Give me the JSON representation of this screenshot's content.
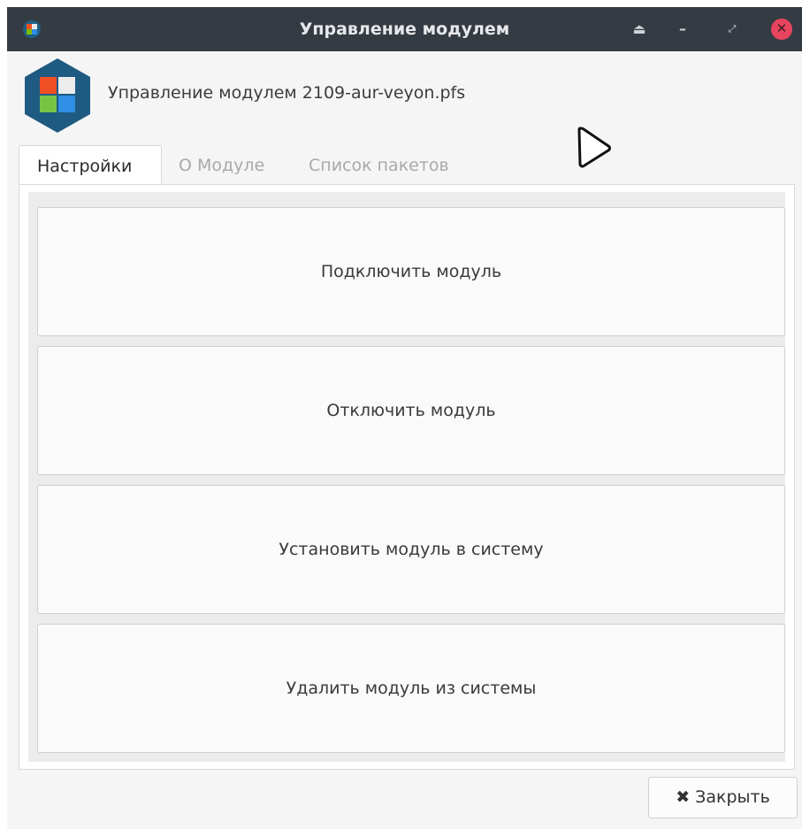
{
  "window": {
    "title": "Управление модулем",
    "controls": [
      "eject-icon",
      "minimize-icon",
      "maximize-icon",
      "close-icon"
    ]
  },
  "header": {
    "module_title": "Управление модулем 2109-aur-veyon.pfs",
    "icon": "module-logo-icon"
  },
  "tabs": [
    {
      "label": "Настройки",
      "active": true
    },
    {
      "label": "О Модуле",
      "active": false
    },
    {
      "label": "Список пакетов",
      "active": false
    }
  ],
  "actions": [
    {
      "label": "Подключить модуль"
    },
    {
      "label": "Отключить модуль"
    },
    {
      "label": "Установить модуль в систему"
    },
    {
      "label": "Удалить модуль из системы"
    }
  ],
  "footer": {
    "close_icon": "✖",
    "close_label": "Закрыть"
  },
  "colors": {
    "titlebar": "#353b43",
    "close_accent": "#e9445f",
    "logo_hex": "#1e5a82"
  }
}
